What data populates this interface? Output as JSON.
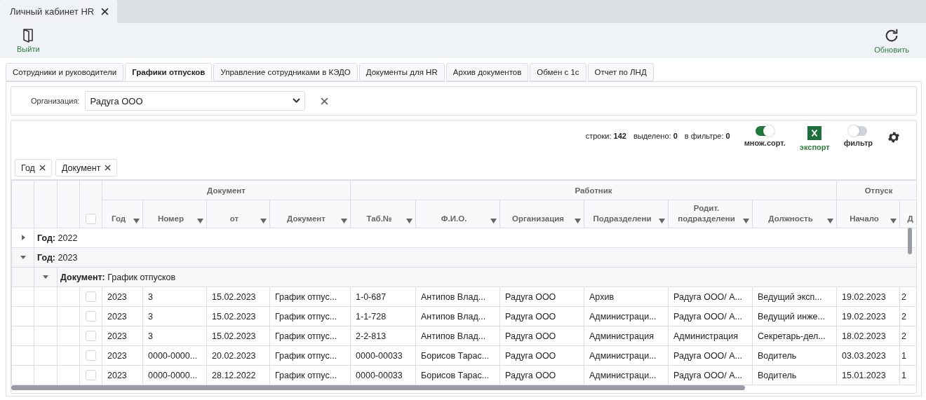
{
  "app_tab": {
    "title": "Личный кабинет HR"
  },
  "exit_button": {
    "label": "Выйти"
  },
  "refresh_button": {
    "label": "Обновить"
  },
  "tabs": [
    {
      "label": "Сотрудники и руководители",
      "selected": false
    },
    {
      "label": "Графики отпусков",
      "selected": true
    },
    {
      "label": "Управление сотрудниками в КЭДО",
      "selected": false
    },
    {
      "label": "Документы для HR",
      "selected": false
    },
    {
      "label": "Архив документов",
      "selected": false
    },
    {
      "label": "Обмен с 1с",
      "selected": false
    },
    {
      "label": "Отчет по ЛНД",
      "selected": false
    }
  ],
  "org_filter": {
    "label": "Организация:",
    "value": "Радуга ООО"
  },
  "stats": [
    {
      "label": "строки:",
      "value": "142"
    },
    {
      "label": "выделено:",
      "value": "0"
    },
    {
      "label": "в фильтре:",
      "value": "0"
    }
  ],
  "multisort": {
    "label": "множ.сорт.",
    "on": true
  },
  "export": {
    "label": "экспорт"
  },
  "filter_toggle": {
    "label": "фильтр",
    "on": false
  },
  "group_chips": [
    "Год",
    "Документ"
  ],
  "table": {
    "all_checked": false,
    "column_groups": [
      {
        "label": "Документ",
        "columns": [
          "Год",
          "Номер",
          "от",
          "Документ"
        ]
      },
      {
        "label": "Работник",
        "columns": [
          "Таб.№",
          "Ф.И.О.",
          "Организация",
          "Подразделени",
          "Родит. подразделени",
          "Должность"
        ]
      },
      {
        "label": "Отпуск",
        "columns": [
          "Начало",
          "Д"
        ]
      }
    ],
    "groups": [
      {
        "label": "Год:",
        "value": "2022",
        "expanded": false
      },
      {
        "label": "Год:",
        "value": "2023",
        "expanded": true,
        "children": [
          {
            "label": "Документ:",
            "value": "График отпусков",
            "expanded": true,
            "rows": [
              {
                "checked": false,
                "cells": [
                  "2023",
                  "3",
                  "15.02.2023",
                  "График отпус...",
                  "1-0-687",
                  "Антипов Влад...",
                  "Радуга ООО",
                  "Архив",
                  "Радуга ООО/ А...",
                  "Ведущий эксп...",
                  "19.02.2023",
                  "2"
                ]
              },
              {
                "checked": false,
                "cells": [
                  "2023",
                  "3",
                  "15.02.2023",
                  "График отпус...",
                  "1-1-728",
                  "Антипов Влад...",
                  "Радуга ООО",
                  "Администраци...",
                  "Радуга ООО/ А...",
                  "Ведущий инже...",
                  "19.02.2023",
                  "2"
                ]
              },
              {
                "checked": false,
                "cells": [
                  "2023",
                  "3",
                  "15.02.2023",
                  "График отпус...",
                  "2-2-813",
                  "Антипов Влад...",
                  "Радуга ООО",
                  "Администрация",
                  "Администрация",
                  "Секретарь-дел...",
                  "18.02.2023",
                  "2"
                ]
              },
              {
                "checked": false,
                "cells": [
                  "2023",
                  "0000-0000...",
                  "20.02.2023",
                  "График отпус...",
                  "0000-00033",
                  "Борисов Тарас...",
                  "Радуга ООО",
                  "Администраци...",
                  "Радуга ООО/ А...",
                  "Водитель",
                  "03.03.2023",
                  "1"
                ]
              },
              {
                "checked": false,
                "cells": [
                  "2023",
                  "0000-0000...",
                  "28.12.2022",
                  "График отпус...",
                  "0000-00033",
                  "Борисов Тарас...",
                  "Радуга ООО",
                  "Администраци...",
                  "Радуга ООО/ А...",
                  "Водитель",
                  "15.01.2023",
                  "1"
                ]
              }
            ]
          }
        ]
      }
    ]
  }
}
